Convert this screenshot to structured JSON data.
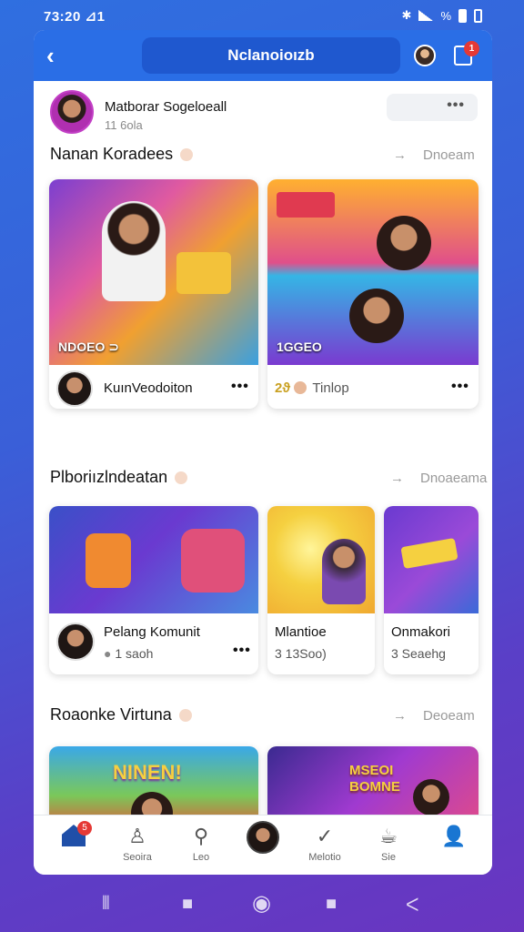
{
  "status": {
    "time": "73:20 ⊿1",
    "battery": "%"
  },
  "appbar": {
    "title": "Nclanoioızb",
    "notification_count": "1"
  },
  "profile": {
    "name": "Matborar Sogeloeall",
    "sub": "11 6ola"
  },
  "sections": [
    {
      "title": "Nanan Koradees",
      "link": "Dnoeam",
      "cards": [
        {
          "label": "NDOEO ⊃",
          "title": "KuınVeodoiton"
        },
        {
          "label": "1GGEO",
          "title": "Tinlop",
          "prefix": "2ϑ"
        }
      ]
    },
    {
      "title": "Plboriızlndeatan",
      "link": "Dnoaeama",
      "cards": [
        {
          "title": "Pelang Komunit",
          "sub": "1 saoh"
        },
        {
          "title": "Mlantioe",
          "sub": "3 13Soo)"
        },
        {
          "title": "Onmakori",
          "sub": "3 Seaehg"
        }
      ]
    },
    {
      "title": "Roaonke Virtuna",
      "link": "Deoeam",
      "cards": [
        {
          "banner": "NINEN!"
        },
        {
          "banner": "MSEOI BOMNE"
        }
      ]
    }
  ],
  "tabbar": {
    "home_badge": "5",
    "tabs": [
      {
        "label": ""
      },
      {
        "label": "Seoira"
      },
      {
        "label": "Leo"
      },
      {
        "label": ""
      },
      {
        "label": "Melotio"
      },
      {
        "label": "Sie"
      },
      {
        "label": ""
      }
    ]
  },
  "icons": [
    "back-icon",
    "avatar-icon",
    "bag-icon",
    "more-icon",
    "home-icon",
    "person-icon",
    "search-icon",
    "check-icon",
    "mug-icon",
    "profile-icon"
  ]
}
